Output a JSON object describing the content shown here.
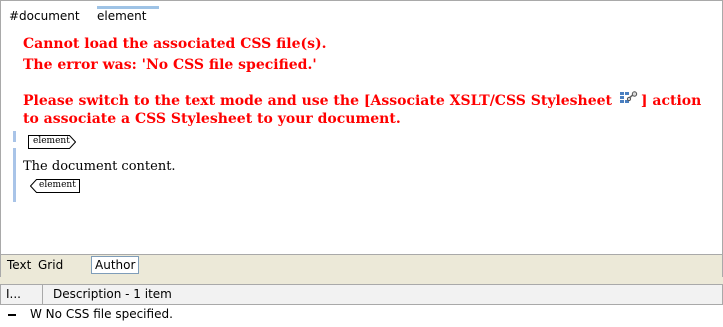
{
  "breadcrumb": {
    "items": [
      "#document",
      "element"
    ]
  },
  "editor": {
    "error_line_1": "Cannot load the associated CSS file(s).",
    "error_line_2": "The error was: 'No CSS file specified.'",
    "error_line_3_before": "Please switch to the text mode and use the [Associate XSLT/CSS Stylesheet ",
    "error_line_3_after": "] action",
    "error_line_4": "to associate a CSS Stylesheet to your document.",
    "start_tag": "element",
    "content": "The document content.",
    "end_tag": "element",
    "error_color": "#ff0000"
  },
  "mode_tabs": {
    "items": [
      "Text",
      "Grid",
      "Author"
    ],
    "selected": "Author"
  },
  "results": {
    "columns": [
      "I...",
      "Description - 1 item"
    ],
    "rows": [
      {
        "severity": "W",
        "description": "No CSS file specified."
      }
    ],
    "row_text": "W No CSS file specified."
  }
}
